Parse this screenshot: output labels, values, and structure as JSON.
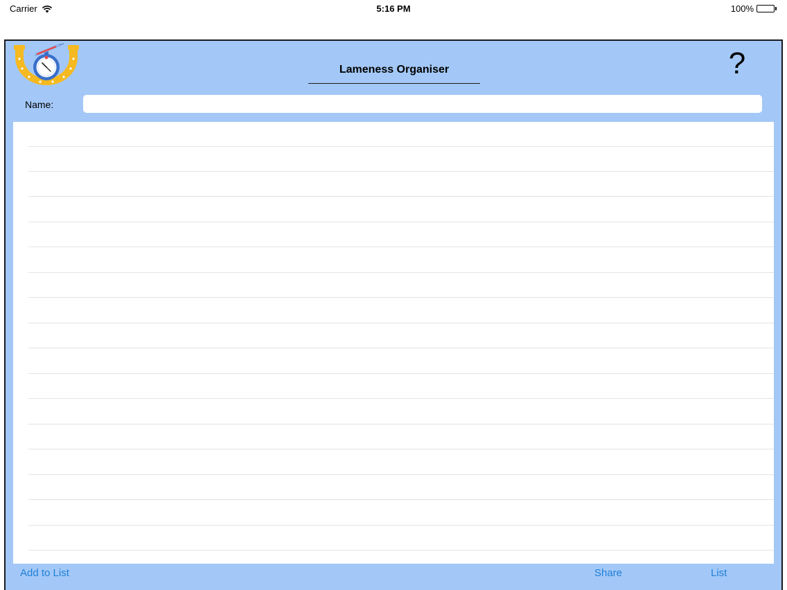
{
  "status_bar": {
    "carrier": "Carrier",
    "time": "5:16 PM",
    "battery": "100%",
    "wifi_icon": "wifi-icon",
    "battery_icon": "battery-icon"
  },
  "header": {
    "title": "Lameness Organiser",
    "help_label": "?",
    "logo_icon": "horseshoe-stopwatch-logo"
  },
  "form": {
    "name_label": "Name:",
    "name_value": "",
    "name_placeholder": ""
  },
  "list": {
    "rows": [
      "",
      "",
      "",
      "",
      "",
      "",
      "",
      "",
      "",
      "",
      "",
      "",
      "",
      "",
      "",
      "",
      ""
    ]
  },
  "toolbar": {
    "add_label": "Add to List",
    "share_label": "Share",
    "list_label": "List"
  },
  "colors": {
    "frame_background": "#a3c8f7",
    "link": "#1f7fd6",
    "logo_gold": "#f5b921",
    "logo_blue": "#3a6fc9"
  }
}
